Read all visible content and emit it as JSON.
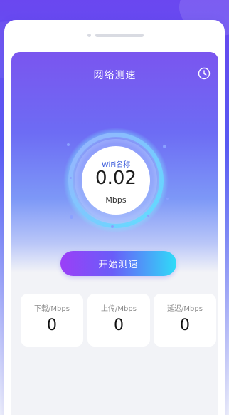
{
  "header": {
    "title": "网络测速",
    "history_icon": "clock-icon"
  },
  "gauge": {
    "label": "WiFi名称",
    "speed_value": "0.02",
    "speed_unit": "Mbps"
  },
  "actions": {
    "start_label": "开始测速"
  },
  "stats": [
    {
      "label": "下载/Mbps",
      "value": "0"
    },
    {
      "label": "上传/Mbps",
      "value": "0"
    },
    {
      "label": "延迟/Mbps",
      "value": "0"
    }
  ],
  "colors": {
    "accent_purple": "#7a55ef",
    "accent_cyan": "#2fdcf8",
    "gauge_label": "#3b5bdb"
  }
}
